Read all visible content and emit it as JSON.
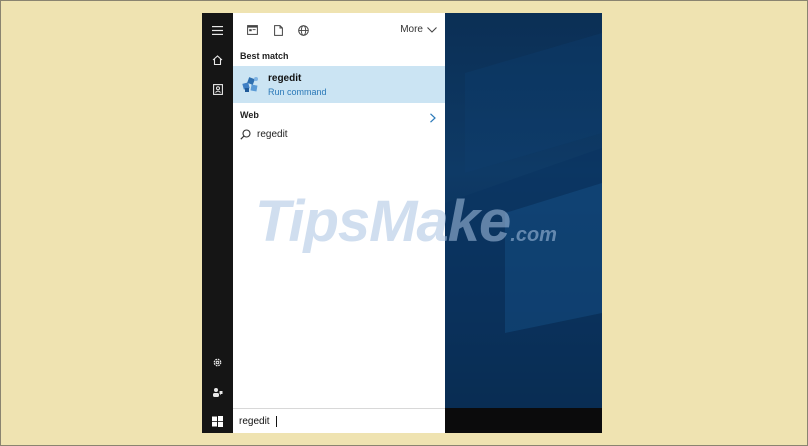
{
  "toolbar": {
    "more_label": "More",
    "icons": [
      "apps-icon",
      "document-icon",
      "globe-icon",
      "chevron-down-icon"
    ]
  },
  "results": {
    "best_match_label": "Best match",
    "best_match": {
      "title": "regedit",
      "subtitle": "Run command",
      "icon": "regedit-icon"
    },
    "web_label": "Web",
    "web_items": [
      {
        "text": "regedit",
        "icon": "search-icon"
      }
    ]
  },
  "search": {
    "value": "regedit"
  },
  "rail": {
    "icons": [
      "hamburger-menu-icon",
      "home-icon",
      "notebook-icon",
      "settings-icon",
      "feedback-icon",
      "windows-start-icon"
    ]
  },
  "watermark": {
    "text": "TipsMake",
    "domain": ".com"
  },
  "colors": {
    "background": "#efe3b1",
    "highlight": "#cbe4f3",
    "subtitle": "#2b79b8",
    "rail": "#151515",
    "desktop": "#0e3a66"
  }
}
